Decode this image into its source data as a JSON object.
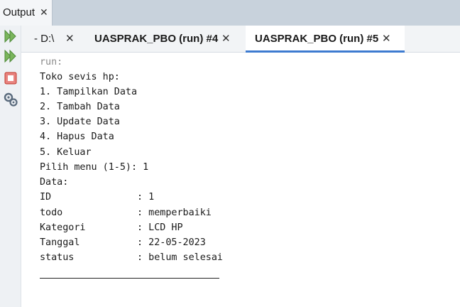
{
  "panel": {
    "title": "Output"
  },
  "tabs": [
    {
      "label": "- D:\\"
    },
    {
      "label": "UASPRAK_PBO (run) #4"
    },
    {
      "label": "UASPRAK_PBO (run) #5"
    }
  ],
  "toolbar": {
    "buttons": [
      "rerun-icon",
      "rerun-with-arguments-icon",
      "stop-icon",
      "settings-icon"
    ]
  },
  "console": {
    "lines": [
      "run:",
      "Toko sevis hp:",
      "1. Tampilkan Data",
      "2. Tambah Data",
      "3. Update Data",
      "4. Hapus Data",
      "5. Keluar",
      "Pilih menu (1-5): 1",
      "Data:",
      "ID               : 1",
      "todo             : memperbaiki",
      "Kategori         : LCD HP",
      "Tanggal          : 22-05-2023",
      "status           : belum selesai"
    ]
  },
  "colors": {
    "accent": "#3d7bd0",
    "stop": "#d9534f",
    "run": "#6aa84f"
  }
}
